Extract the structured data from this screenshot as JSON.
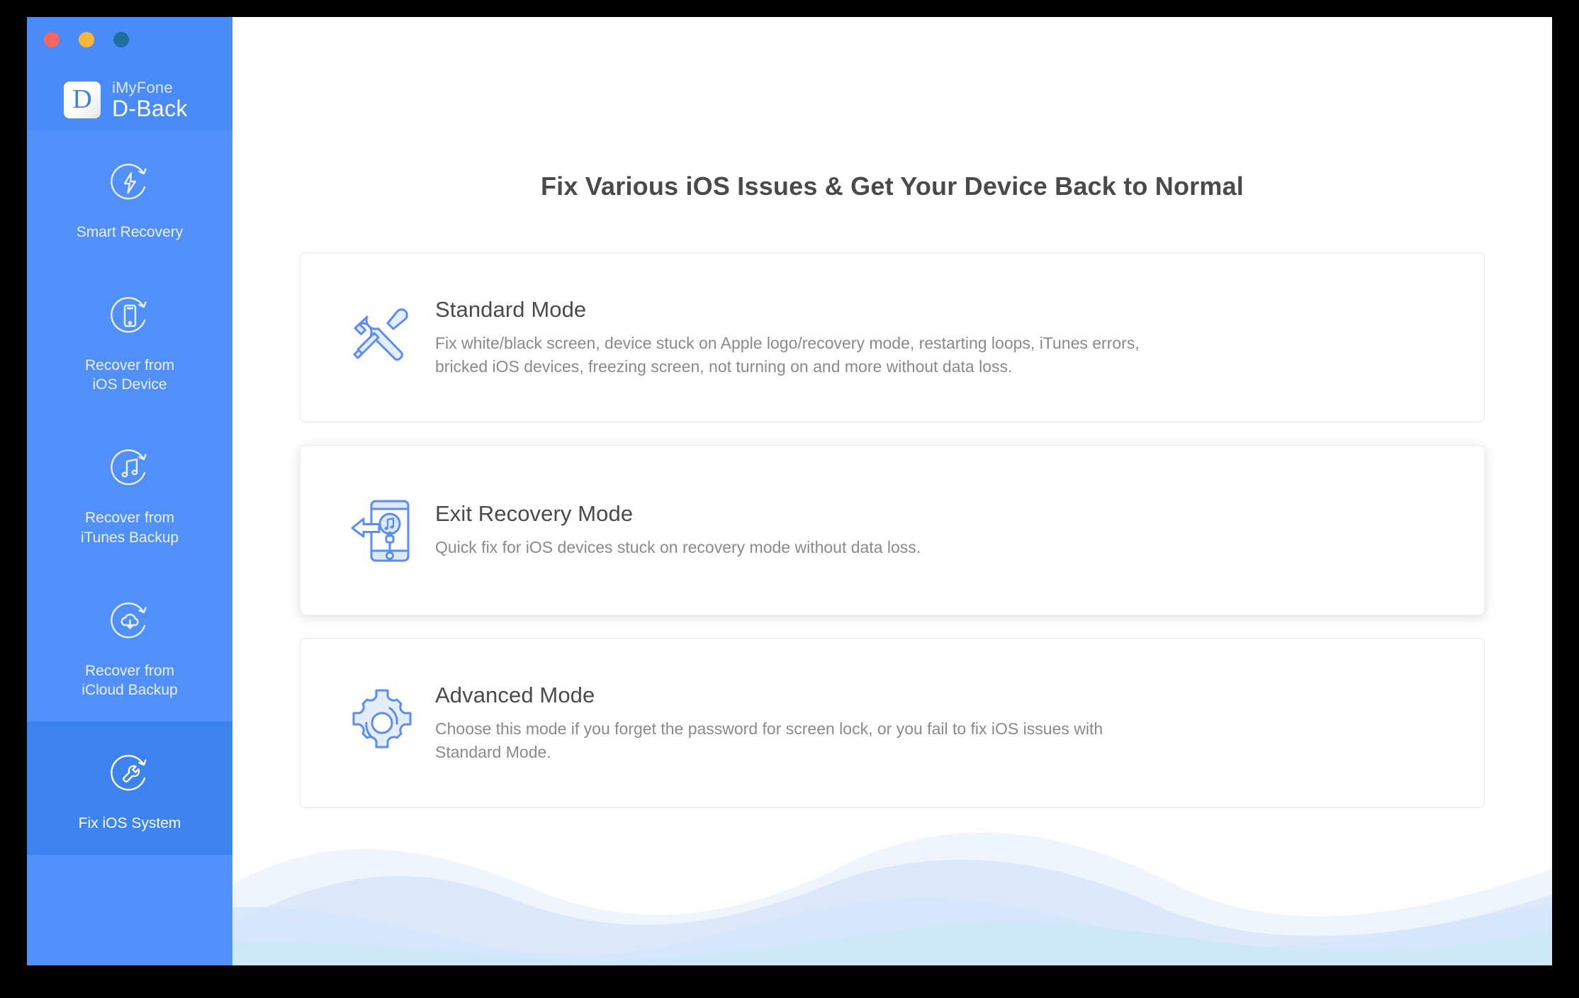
{
  "window": {
    "traffic_lights": [
      {
        "name": "close",
        "color": "#F2675F"
      },
      {
        "name": "minimize",
        "color": "#F8B63A"
      },
      {
        "name": "zoom",
        "color": "#1E6FA0"
      }
    ]
  },
  "brand": {
    "logo_letter": "D",
    "company": "iMyFone",
    "product": "D-Back"
  },
  "sidebar": {
    "background": "#5190FB",
    "active_background": "#3D83EF",
    "items": [
      {
        "label": "Smart Recovery",
        "icon": "bolt-refresh-icon",
        "active": false
      },
      {
        "label": "Recover from\niOS Device",
        "icon": "phone-refresh-icon",
        "active": false
      },
      {
        "label": "Recover from\niTunes Backup",
        "icon": "music-note-refresh-icon",
        "active": false
      },
      {
        "label": "Recover from\niCloud Backup",
        "icon": "cloud-download-refresh-icon",
        "active": false
      },
      {
        "label": "Fix iOS System",
        "icon": "wrench-refresh-icon",
        "active": true
      }
    ]
  },
  "main": {
    "title": "Fix Various iOS Issues & Get Your Device Back to Normal",
    "accent": "#4A8BFA",
    "cards": [
      {
        "title": "Standard Mode",
        "desc": "Fix white/black screen, device stuck on Apple logo/recovery mode, restarting loops, iTunes errors, bricked iOS devices, freezing screen, not turning on and more without data loss.",
        "icon": "wrench-screwdriver-icon",
        "highlight": false
      },
      {
        "title": "Exit Recovery Mode",
        "desc": "Quick fix for iOS devices stuck on recovery mode without data loss.",
        "icon": "phone-exit-recovery-icon",
        "highlight": true
      },
      {
        "title": "Advanced Mode",
        "desc": "Choose this mode if you forget the password for screen lock, or you fail to fix iOS issues with Standard Mode.",
        "icon": "gear-icon",
        "highlight": false
      }
    ]
  }
}
